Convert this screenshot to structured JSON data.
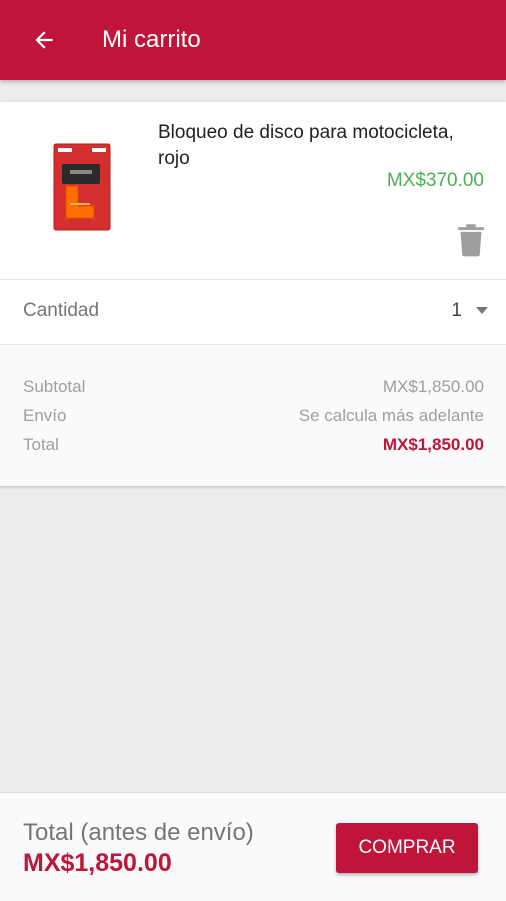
{
  "header": {
    "title": "Mi carrito",
    "back_icon": "arrow-left-icon"
  },
  "cart_item": {
    "name": "Bloqueo de disco para motocicleta, rojo",
    "price": "MX$370.00",
    "price_color": "#4caf50",
    "delete_icon": "trash-icon"
  },
  "quantity": {
    "label": "Cantidad",
    "value": "1"
  },
  "summary": {
    "subtotal_label": "Subtotal",
    "subtotal_value": "MX$1,850.00",
    "shipping_label": "Envío",
    "shipping_value": "Se calcula más adelante",
    "total_label": "Total",
    "total_value": "MX$1,850.00"
  },
  "footer": {
    "total_label": "Total (antes de envío)",
    "total_value": "MX$1,850.00",
    "buy_label": "COMPRAR"
  },
  "colors": {
    "brand": "#c0143a",
    "price_green": "#4caf50"
  }
}
